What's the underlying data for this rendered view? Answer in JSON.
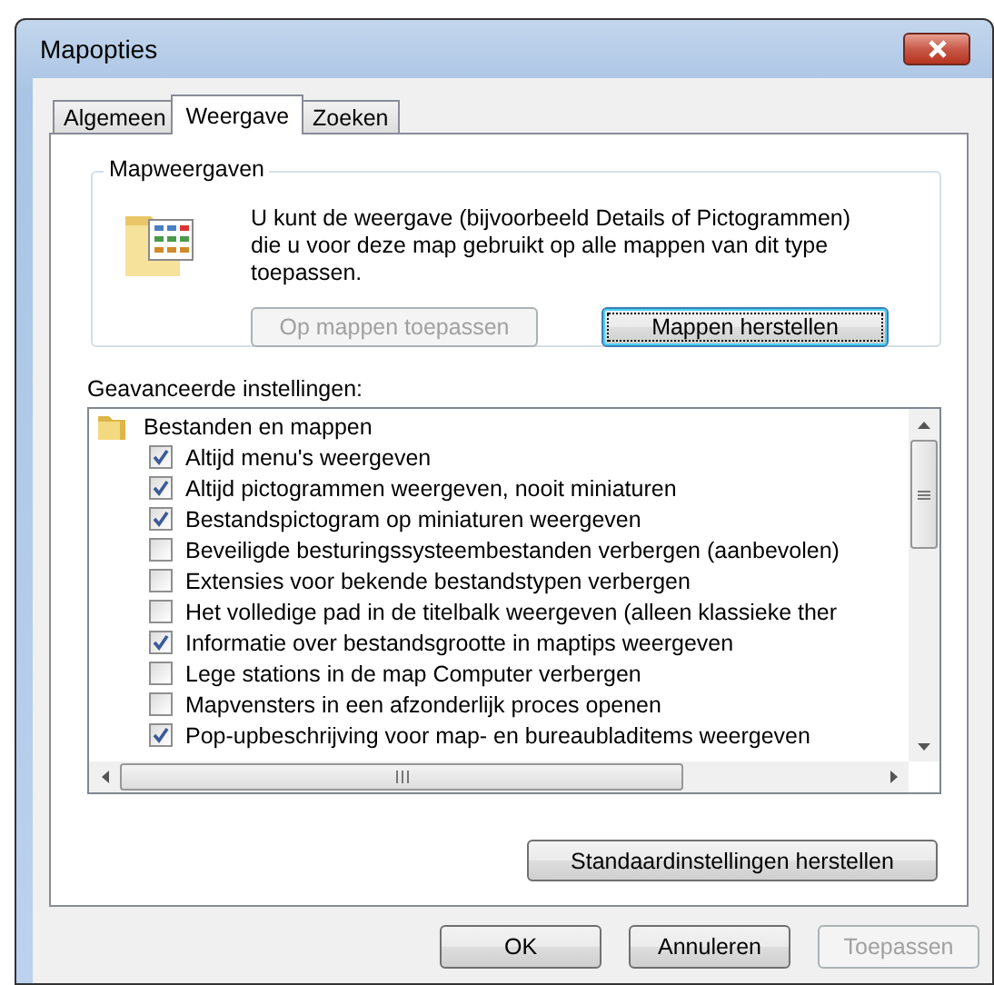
{
  "window": {
    "title": "Mapopties"
  },
  "tabs": [
    {
      "label": "Algemeen",
      "selected": false
    },
    {
      "label": "Weergave",
      "selected": true
    },
    {
      "label": "Zoeken",
      "selected": false
    }
  ],
  "folder_views": {
    "title": "Mapweergaven",
    "description": "U kunt de weergave (bijvoorbeeld Details of Pictogrammen) die u voor deze map gebruikt op alle mappen van dit type toepassen.",
    "buttons": [
      {
        "label": "Op mappen toepassen",
        "disabled": true,
        "focused": false
      },
      {
        "label": "Mappen herstellen",
        "disabled": false,
        "focused": true
      }
    ]
  },
  "advanced": {
    "label": "Geavanceerde instellingen:",
    "items": [
      {
        "label": "Bestanden en mappen",
        "kind": "folder",
        "children": [
          {
            "label": "Altijd menu's weergeven",
            "kind": "checkbox",
            "checked": true
          },
          {
            "label": "Altijd pictogrammen weergeven, nooit miniaturen",
            "kind": "checkbox",
            "checked": true
          },
          {
            "label": "Bestandspictogram op miniaturen weergeven",
            "kind": "checkbox",
            "checked": true
          },
          {
            "label": "Beveiligde besturingssysteembestanden verbergen (aanbevolen)",
            "kind": "checkbox",
            "checked": false
          },
          {
            "label": "Extensies voor bekende bestandstypen verbergen",
            "kind": "checkbox",
            "checked": false
          },
          {
            "label": "Het volledige pad in de titelbalk weergeven (alleen klassieke ther",
            "kind": "checkbox",
            "checked": false
          },
          {
            "label": "Informatie over bestandsgrootte in maptips weergeven",
            "kind": "checkbox",
            "checked": true
          },
          {
            "label": "Lege stations in de map Computer verbergen",
            "kind": "checkbox",
            "checked": false
          },
          {
            "label": "Mapvensters in een afzonderlijk proces openen",
            "kind": "checkbox",
            "checked": false
          },
          {
            "label": "Pop-upbeschrijving voor map- en bureaubladitems weergeven",
            "kind": "checkbox",
            "checked": true
          }
        ]
      }
    ]
  },
  "restore_button": {
    "label": "Standaardinstellingen herstellen"
  },
  "buttons": [
    {
      "label": "OK",
      "disabled": false
    },
    {
      "label": "Annuleren",
      "disabled": false
    },
    {
      "label": "Toepassen",
      "disabled": true
    }
  ]
}
